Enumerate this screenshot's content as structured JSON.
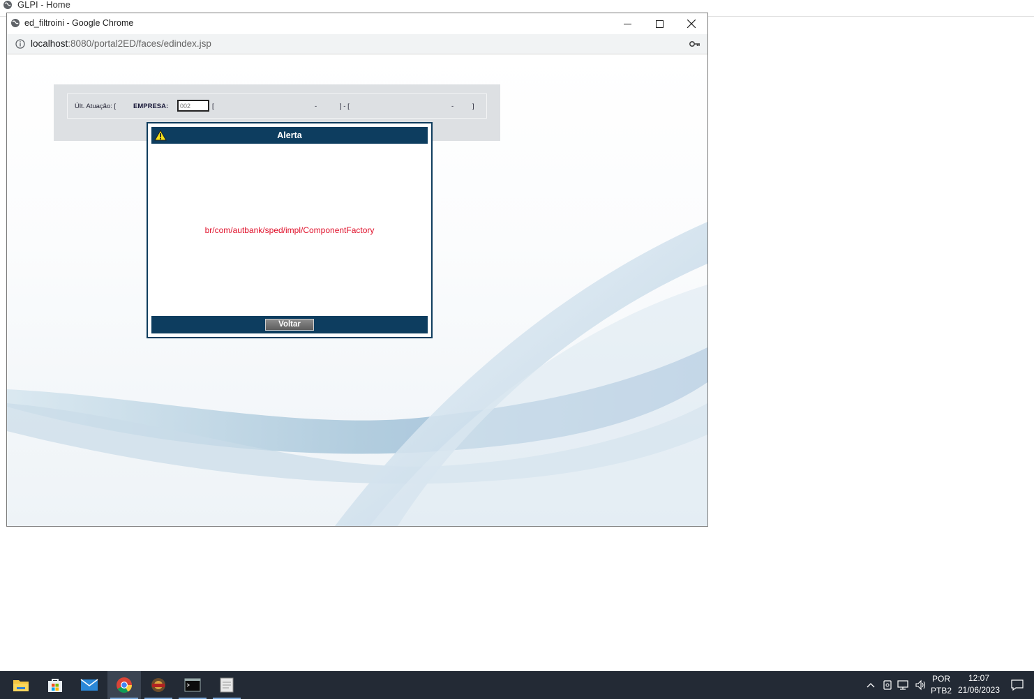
{
  "background_tab": {
    "title": "GLPI - Home",
    "icon": "globe-icon"
  },
  "window": {
    "title": "ed_filtroini - Google Chrome",
    "url_host": "localhost",
    "url_rest": ":8080/portal2ED/faces/edindex.jsp"
  },
  "filter": {
    "ult_label": "Últ. Atuação: [",
    "empresa_label": "EMPRESA:",
    "empresa_value": "002",
    "bracket_open": "[",
    "dash1": "-",
    "sep": "] - [",
    "dash2": "-",
    "bracket_close": "]"
  },
  "alert": {
    "title": "Alerta",
    "message": "br/com/autbank/sped/impl/ComponentFactory",
    "button": "Voltar"
  },
  "taskbar": {
    "items": [
      "file-explorer-icon",
      "store-icon",
      "mail-icon",
      "chrome-icon",
      "app-icon",
      "terminal-icon",
      "notepad-icon"
    ],
    "lang_top": "POR",
    "lang_bottom": "PTB2",
    "time": "12:07",
    "date": "21/06/2023"
  }
}
